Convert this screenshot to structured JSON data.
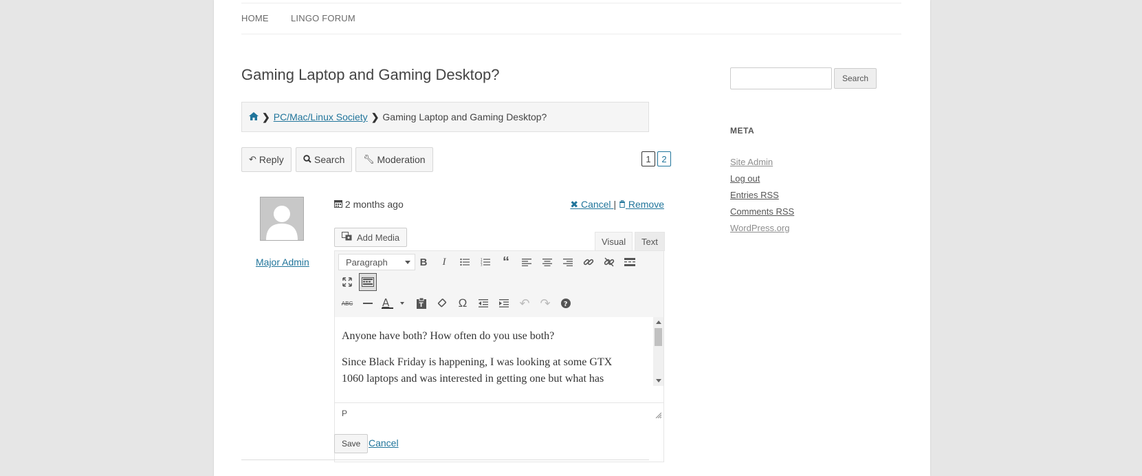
{
  "nav": {
    "items": [
      "HOME",
      "LINGO FORUM"
    ]
  },
  "post": {
    "title": "Gaming Laptop and Gaming Desktop?",
    "breadcrumb": {
      "parent": "PC/Mac/Linux Society",
      "current": "Gaming Laptop and Gaming Desktop?"
    },
    "buttons": {
      "reply": "Reply",
      "search": "Search",
      "moderation": "Moderation"
    },
    "pages": [
      "1",
      "2"
    ],
    "current_page": "2",
    "author": "Major Admin",
    "date": "2 months ago",
    "actions": {
      "cancel": "Cancel",
      "separator": "|",
      "remove": "Remove"
    }
  },
  "editor": {
    "add_media": "Add Media",
    "tabs": {
      "visual": "Visual",
      "text": "Text"
    },
    "format": "Paragraph",
    "content": [
      "Anyone have both? How often do you use both?",
      "Since Black Friday is happening, I was looking at some GTX 1060 laptops and was interested in getting one but what has"
    ],
    "status_path": "P",
    "save": "Save",
    "cancel": "Cancel"
  },
  "sidebar": {
    "search_button": "Search",
    "meta_title": "META",
    "meta_links": [
      "Site Admin",
      "Log out",
      "Entries RSS",
      "Comments RSS",
      "WordPress.org"
    ]
  },
  "icons": {
    "home": "home-icon",
    "reply": "reply-icon",
    "search": "search-icon",
    "moderation": "wrench-icon",
    "calendar": "calendar-icon",
    "close": "close-icon",
    "trash": "trash-icon"
  },
  "colors": {
    "link": "#21759b",
    "page_bg": "#e6e6e6",
    "content_bg": "#ffffff"
  }
}
